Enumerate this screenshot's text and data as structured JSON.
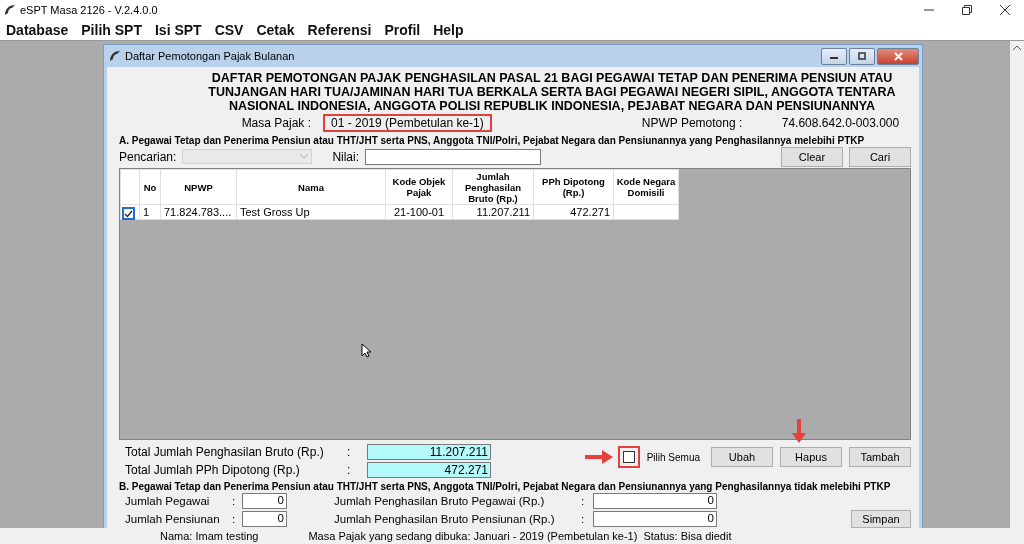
{
  "app": {
    "title": "eSPT Masa 2126 - V.2.4.0.0"
  },
  "menu": [
    "Database",
    "Pilih SPT",
    "Isi SPT",
    "CSV",
    "Cetak",
    "Referensi",
    "Profil",
    "Help"
  ],
  "dialog": {
    "title": "Daftar Pemotongan Pajak Bulanan",
    "heading": "DAFTAR PEMOTONGAN PAJAK PENGHASILAN PASAL 21 BAGI PEGAWAI TETAP DAN PENERIMA PENSIUN ATAU TUNJANGAN HARI TUA/JAMINAN HARI TUA BERKALA SERTA BAGI PEGAWAI NEGERI SIPIL, ANGGOTA TENTARA NASIONAL INDONESIA, ANGGOTA POLISI REPUBLIK INDONESIA, PEJABAT NEGARA DAN PENSIUNANNYA",
    "masa_pajak": {
      "label": "Masa Pajak :",
      "value": "01 - 2019 (Pembetulan ke-1)"
    },
    "npwp_pemotong": {
      "label": "NPWP Pemotong :",
      "value": "74.608.642.0-003.000"
    },
    "section_a": "A. Pegawai Tetap dan Penerima Pensiun atau THT/JHT serta PNS, Anggota TNI/Polri, Pejabat Negara dan Pensiunannya yang Penghasilannya melebihi PTKP",
    "search": {
      "label": "Pencarian:",
      "disabled": true,
      "value_label": "Nilai:"
    },
    "search_buttons": [
      "Clear",
      "Cari"
    ],
    "table": {
      "columns": [
        "No",
        "NPWP",
        "Nama",
        "Kode Objek Pajak",
        "Jumlah Penghasilan Bruto (Rp.)",
        "PPh Dipotong (Rp.)",
        "Kode Negara Domisili"
      ],
      "rows": [
        {
          "checked": true,
          "cells": [
            "1",
            "71.824.783....",
            "Test Gross Up",
            "21-100-01",
            "11.207.211",
            "472.271",
            ""
          ]
        }
      ]
    },
    "totals": [
      {
        "label": "Total Jumlah Penghasilan Bruto (Rp.)",
        "colon": ":",
        "value": "11.207.211"
      },
      {
        "label": "Total Jumlah PPh Dipotong (Rp.)",
        "colon": ":",
        "value": "472.271"
      }
    ],
    "select_all": {
      "label": "Pilih Semua",
      "checked": false
    },
    "action_buttons": [
      "Ubah",
      "Hapus",
      "Tambah"
    ],
    "section_b": "B. Pegawai Tetap dan Penerima Pensiun atau THT/JHT serta PNS, Anggota TNI/Polri, Pejabat Negara dan Pensiunannya yang Penghasilannya tidak melebihi PTKP",
    "section_b_rows": [
      {
        "label": "Jumlah Pegawai",
        "colon": ":",
        "value": "0",
        "label2": "Jumlah Penghasilan Bruto Pegawai (Rp.)",
        "colon2": ":",
        "value2": "0"
      },
      {
        "label": "Jumlah Pensiunan",
        "colon": ":",
        "value": "0",
        "label2": "Jumlah Penghasilan Bruto Pensiunan (Rp.)",
        "colon2": ":",
        "value2": "0"
      }
    ],
    "save_button": "Simpan"
  },
  "status_bar": [
    "Nama: Imam testing",
    "Masa Pajak yang sedang dibuka: Januari - 2019 (Pembetulan ke-1)",
    "Status: Bisa diedit"
  ]
}
